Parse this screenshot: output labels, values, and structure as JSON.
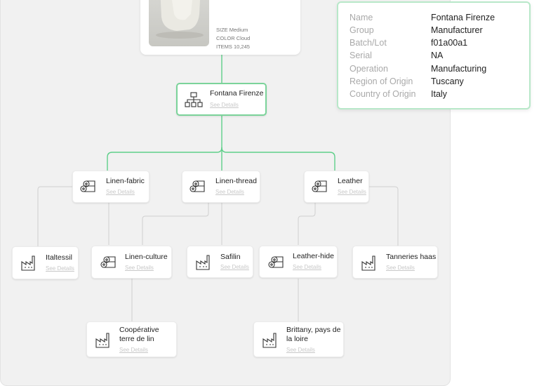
{
  "product": {
    "size": "SIZE Medium",
    "color": "COLOR Cloud",
    "items": "ITEMS 10,245"
  },
  "info_panel": {
    "rows": [
      {
        "label": "Name",
        "value": "Fontana Firenze"
      },
      {
        "label": "Group",
        "value": "Manufacturer"
      },
      {
        "label": "Batch/Lot",
        "value": "f01a00a1"
      },
      {
        "label": "Serial",
        "value": "NA"
      },
      {
        "label": "Operation",
        "value": "Manufacturing"
      },
      {
        "label": "Region of Origin",
        "value": "Tuscany"
      },
      {
        "label": "Country of Origin",
        "value": "Italy"
      }
    ]
  },
  "see_details": "See Details",
  "nodes": {
    "root": {
      "name": "Fontana Firenze",
      "icon": "hierarchy-icon"
    },
    "linen_fabric": {
      "name": "Linen-fabric",
      "icon": "fabric-rolls-icon"
    },
    "linen_thread": {
      "name": "Linen-thread",
      "icon": "fabric-rolls-icon"
    },
    "leather": {
      "name": "Leather",
      "icon": "fabric-rolls-icon"
    },
    "italtessil": {
      "name": "Italtessil",
      "icon": "factory-icon"
    },
    "linen_culture": {
      "name": "Linen-culture",
      "icon": "fabric-rolls-icon"
    },
    "safilin": {
      "name": "Safilin",
      "icon": "factory-icon"
    },
    "leather_hide": {
      "name": "Leather-hide",
      "icon": "fabric-rolls-icon"
    },
    "tanneries_haas": {
      "name": "Tanneries haas",
      "icon": "factory-icon"
    },
    "cooperative": {
      "name": "Coopérative terre de lin",
      "icon": "factory-icon"
    },
    "brittany": {
      "name": "Brittany, pays de la loire",
      "icon": "factory-icon"
    }
  },
  "colors": {
    "accent_green": "#5fcf8a",
    "connector_gray": "#cfcfcf",
    "panel_bg": "#f1f1f1"
  }
}
